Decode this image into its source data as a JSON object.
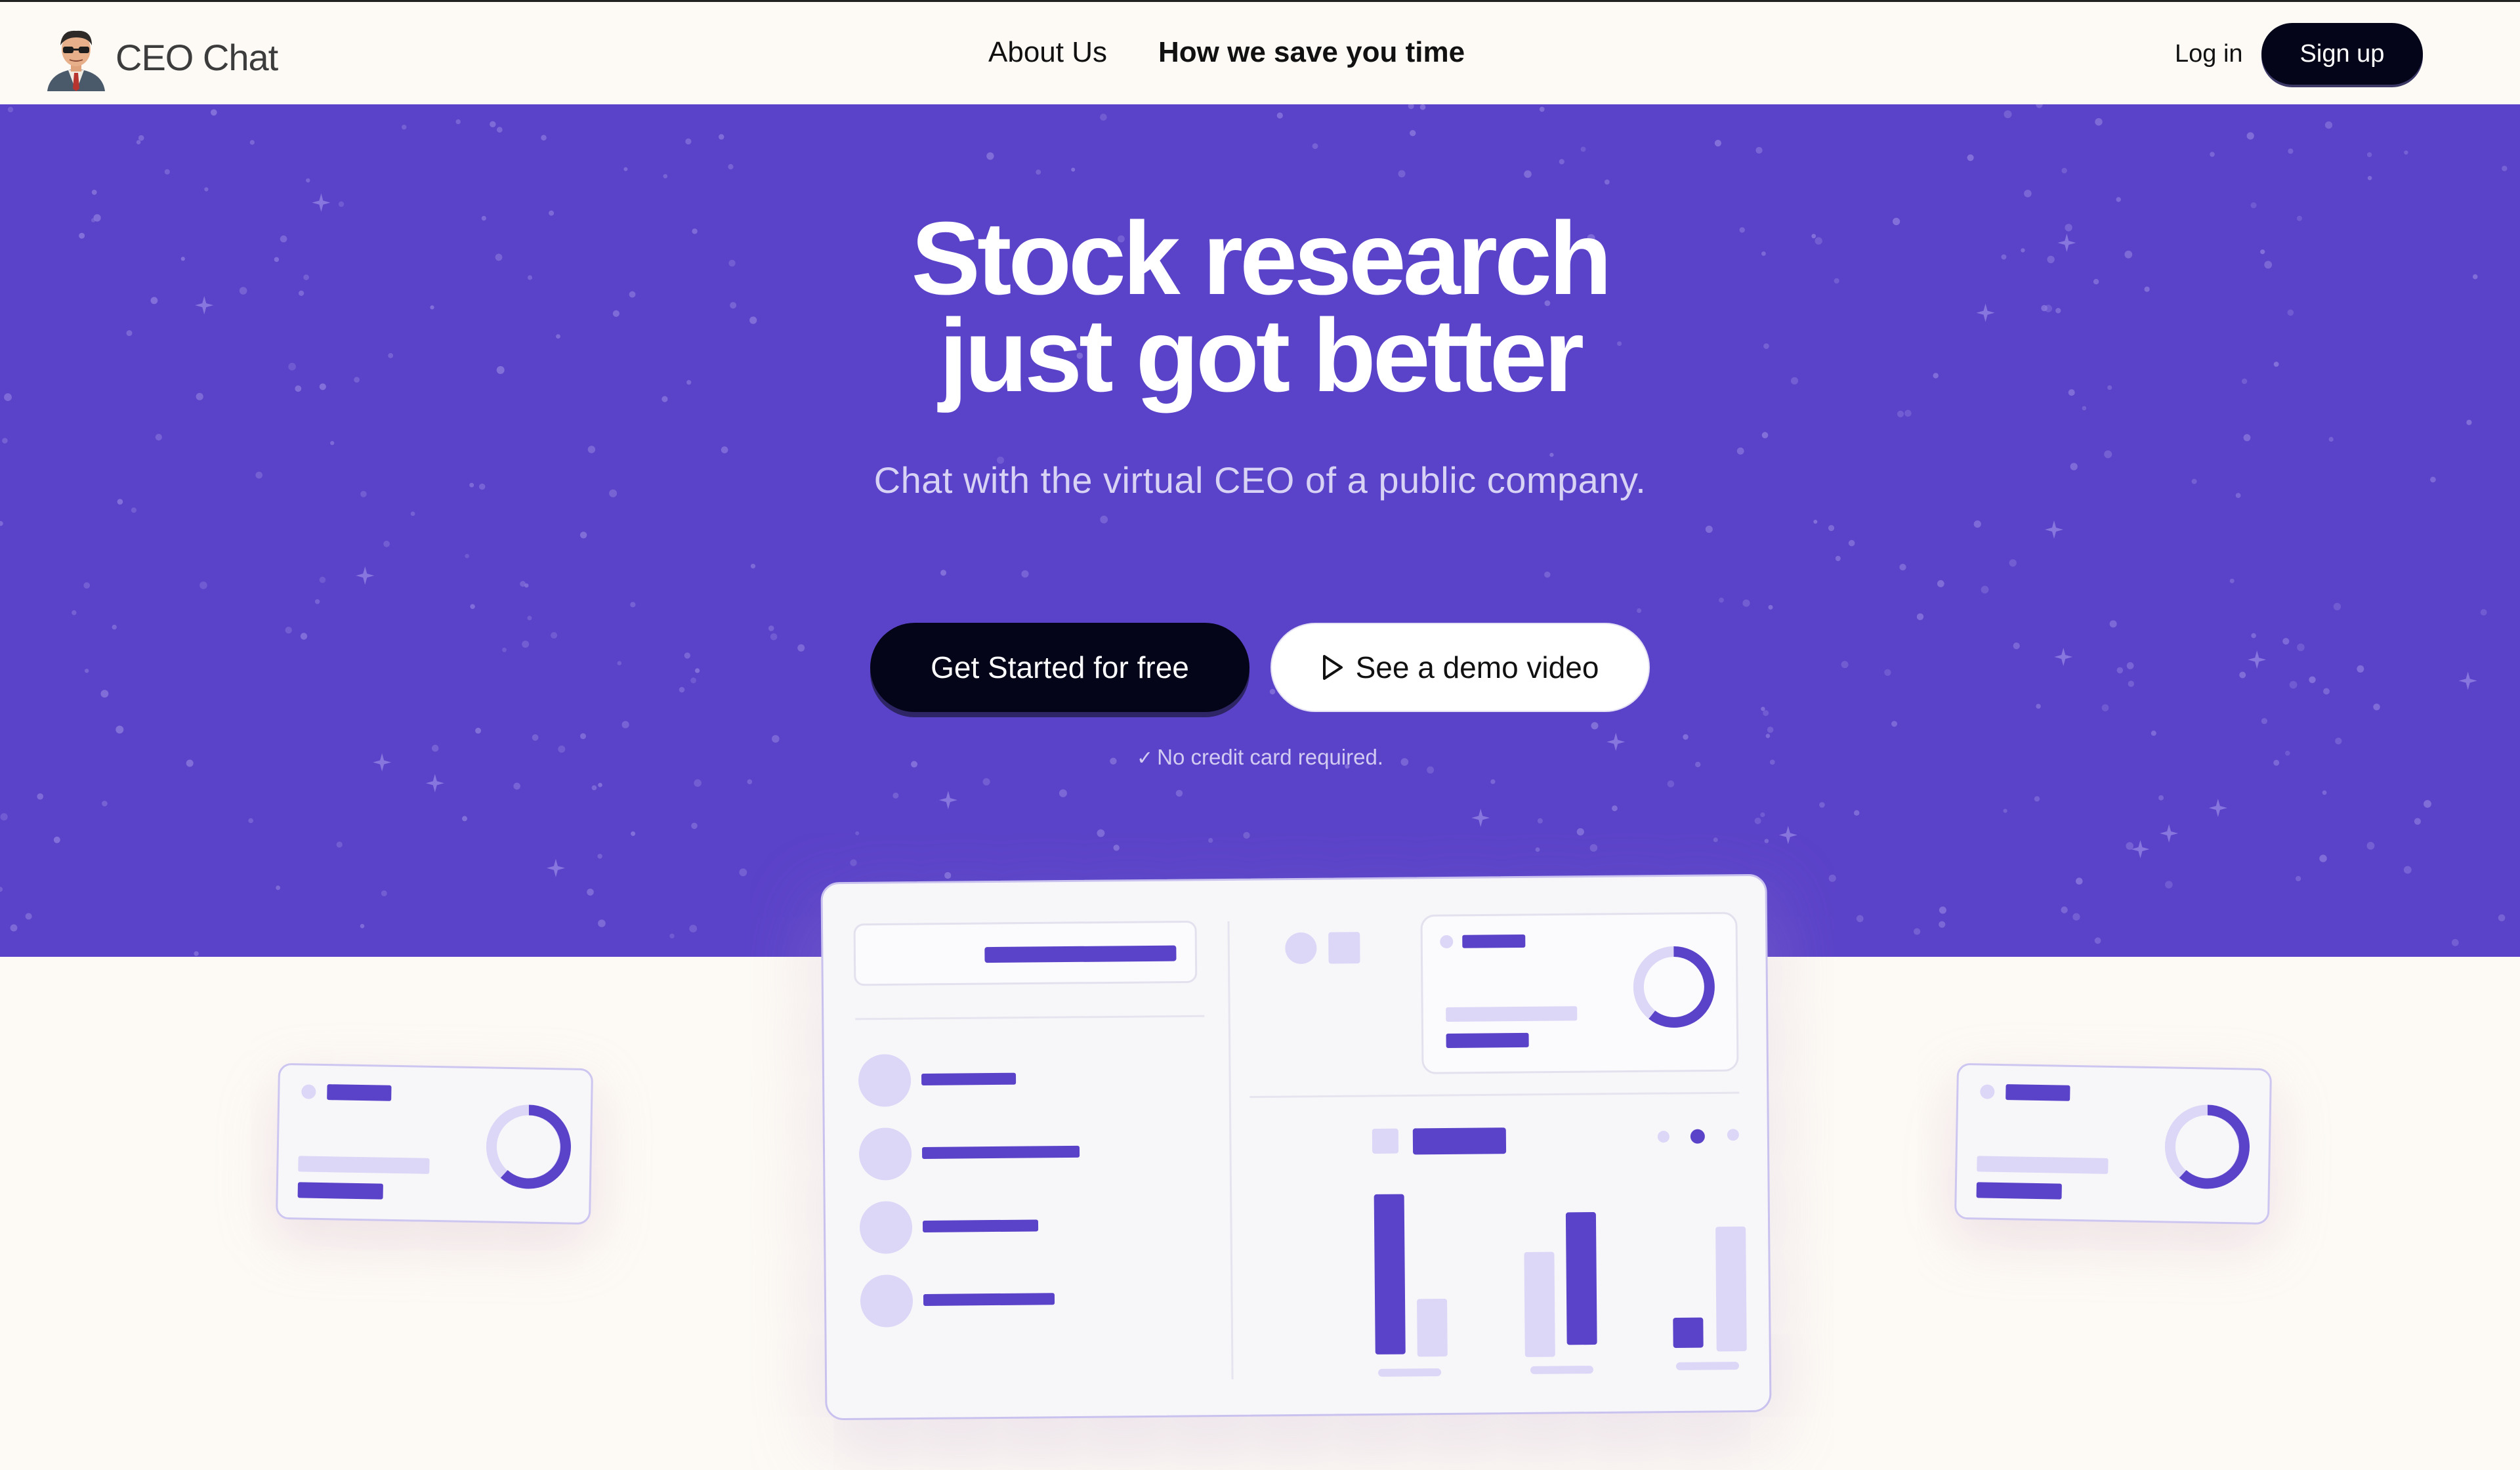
{
  "brand": {
    "name": "CEO Chat",
    "logo_icon": "ceo-avatar-icon"
  },
  "nav": {
    "about": "About Us",
    "save_time": "How we save you time"
  },
  "auth": {
    "login": "Log in",
    "signup": "Sign up"
  },
  "hero": {
    "headline_line1": "Stock research",
    "headline_line2": "just got better",
    "subhead": "Chat with the virtual CEO of a public company.",
    "cta_primary": "Get Started for free",
    "cta_secondary": "See a demo video",
    "cta_secondary_icon": "play-icon",
    "note": "No credit card required.",
    "note_icon": "check-icon"
  },
  "colors": {
    "hero_bg": "#5b43c9",
    "page_bg": "#fdfaf5",
    "accent": "#5b43c9",
    "accent_light": "#dcd6f7",
    "button_dark": "#05051a"
  }
}
